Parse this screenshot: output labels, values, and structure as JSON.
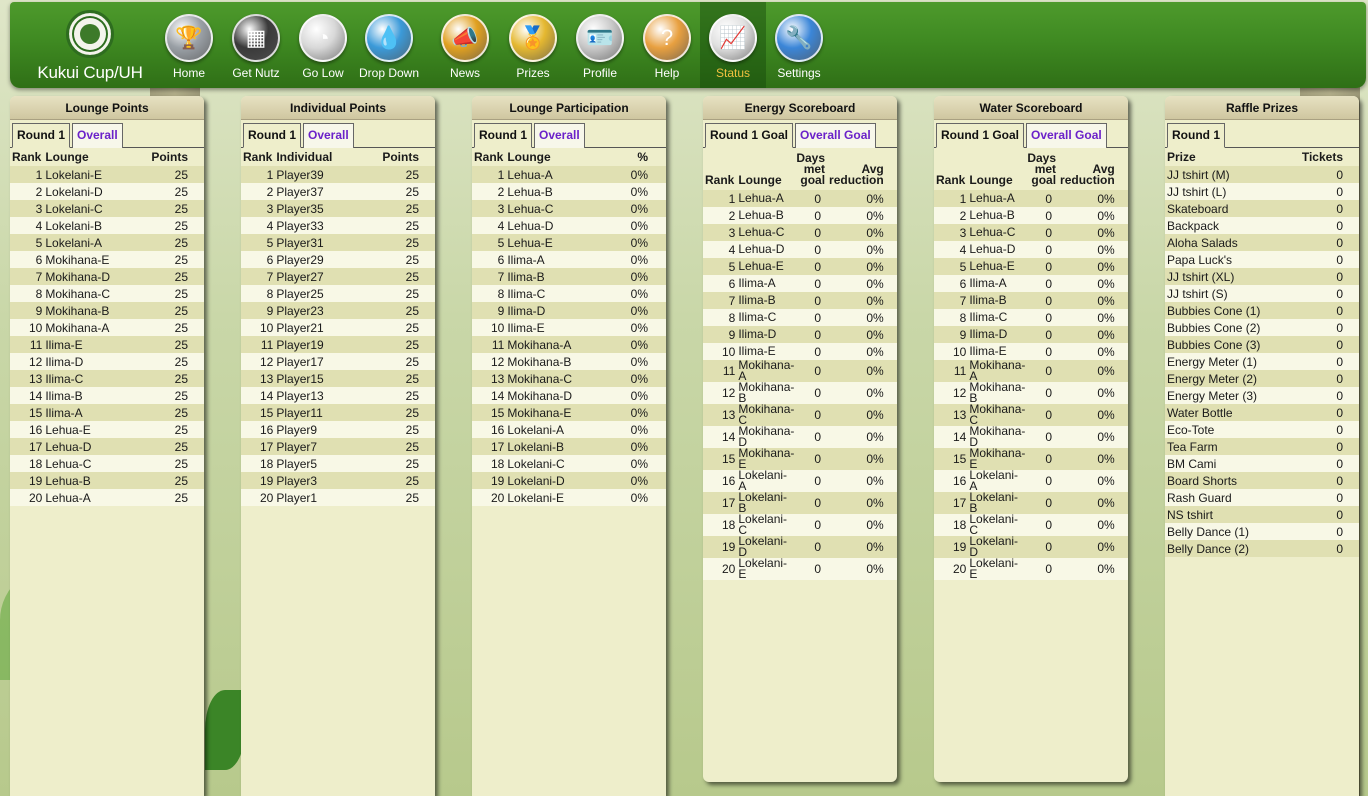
{
  "brand": {
    "name": "Kukui Cup/UH"
  },
  "nav": [
    {
      "label": "Home",
      "icon": "trophy-icon",
      "color": "#9aa0a6",
      "glyph": "🏆"
    },
    {
      "label": "Get Nutz",
      "icon": "scoreboard-icon",
      "color": "#3a3a3a",
      "glyph": "▦"
    },
    {
      "label": "Go Low",
      "icon": "gauge-icon",
      "color": "#d8d8d8",
      "glyph": "◔"
    },
    {
      "label": "Drop Down",
      "icon": "water-drop-icon",
      "color": "#3b9ad9",
      "glyph": "💧"
    },
    {
      "label": "News",
      "icon": "megaphone-icon",
      "color": "#e0a020",
      "glyph": "📣"
    },
    {
      "label": "Prizes",
      "icon": "medal-icon",
      "color": "#e5b830",
      "glyph": "🏅"
    },
    {
      "label": "Profile",
      "icon": "id-card-icon",
      "color": "#c9c9c9",
      "glyph": "🪪"
    },
    {
      "label": "Help",
      "icon": "question-icon",
      "color": "#e8a040",
      "glyph": "?"
    },
    {
      "label": "Status",
      "icon": "status-chart-icon",
      "color": "#e0e0e0",
      "glyph": "📈"
    },
    {
      "label": "Settings",
      "icon": "wrench-icon",
      "color": "#3b86d8",
      "glyph": "🔧"
    }
  ],
  "lounge_points": {
    "title": "Lounge Points",
    "tabs": [
      "Round 1",
      "Overall"
    ],
    "headers": [
      "Rank",
      "Lounge",
      "Points"
    ],
    "rows": [
      [
        "1",
        "Lokelani-E",
        "25"
      ],
      [
        "2",
        "Lokelani-D",
        "25"
      ],
      [
        "3",
        "Lokelani-C",
        "25"
      ],
      [
        "4",
        "Lokelani-B",
        "25"
      ],
      [
        "5",
        "Lokelani-A",
        "25"
      ],
      [
        "6",
        "Mokihana-E",
        "25"
      ],
      [
        "7",
        "Mokihana-D",
        "25"
      ],
      [
        "8",
        "Mokihana-C",
        "25"
      ],
      [
        "9",
        "Mokihana-B",
        "25"
      ],
      [
        "10",
        "Mokihana-A",
        "25"
      ],
      [
        "11",
        "Ilima-E",
        "25"
      ],
      [
        "12",
        "Ilima-D",
        "25"
      ],
      [
        "13",
        "Ilima-C",
        "25"
      ],
      [
        "14",
        "Ilima-B",
        "25"
      ],
      [
        "15",
        "Ilima-A",
        "25"
      ],
      [
        "16",
        "Lehua-E",
        "25"
      ],
      [
        "17",
        "Lehua-D",
        "25"
      ],
      [
        "18",
        "Lehua-C",
        "25"
      ],
      [
        "19",
        "Lehua-B",
        "25"
      ],
      [
        "20",
        "Lehua-A",
        "25"
      ]
    ]
  },
  "individual_points": {
    "title": "Individual Points",
    "tabs": [
      "Round 1",
      "Overall"
    ],
    "headers": [
      "Rank",
      "Individual",
      "Points"
    ],
    "rows": [
      [
        "1",
        "Player39",
        "25"
      ],
      [
        "2",
        "Player37",
        "25"
      ],
      [
        "3",
        "Player35",
        "25"
      ],
      [
        "4",
        "Player33",
        "25"
      ],
      [
        "5",
        "Player31",
        "25"
      ],
      [
        "6",
        "Player29",
        "25"
      ],
      [
        "7",
        "Player27",
        "25"
      ],
      [
        "8",
        "Player25",
        "25"
      ],
      [
        "9",
        "Player23",
        "25"
      ],
      [
        "10",
        "Player21",
        "25"
      ],
      [
        "11",
        "Player19",
        "25"
      ],
      [
        "12",
        "Player17",
        "25"
      ],
      [
        "13",
        "Player15",
        "25"
      ],
      [
        "14",
        "Player13",
        "25"
      ],
      [
        "15",
        "Player11",
        "25"
      ],
      [
        "16",
        "Player9",
        "25"
      ],
      [
        "17",
        "Player7",
        "25"
      ],
      [
        "18",
        "Player5",
        "25"
      ],
      [
        "19",
        "Player3",
        "25"
      ],
      [
        "20",
        "Player1",
        "25"
      ]
    ]
  },
  "lounge_participation": {
    "title": "Lounge Participation",
    "tabs": [
      "Round 1",
      "Overall"
    ],
    "headers": [
      "Rank",
      "Lounge",
      "%"
    ],
    "rows": [
      [
        "1",
        "Lehua-A",
        "0%"
      ],
      [
        "2",
        "Lehua-B",
        "0%"
      ],
      [
        "3",
        "Lehua-C",
        "0%"
      ],
      [
        "4",
        "Lehua-D",
        "0%"
      ],
      [
        "5",
        "Lehua-E",
        "0%"
      ],
      [
        "6",
        "Ilima-A",
        "0%"
      ],
      [
        "7",
        "Ilima-B",
        "0%"
      ],
      [
        "8",
        "Ilima-C",
        "0%"
      ],
      [
        "9",
        "Ilima-D",
        "0%"
      ],
      [
        "10",
        "Ilima-E",
        "0%"
      ],
      [
        "11",
        "Mokihana-A",
        "0%"
      ],
      [
        "12",
        "Mokihana-B",
        "0%"
      ],
      [
        "13",
        "Mokihana-C",
        "0%"
      ],
      [
        "14",
        "Mokihana-D",
        "0%"
      ],
      [
        "15",
        "Mokihana-E",
        "0%"
      ],
      [
        "16",
        "Lokelani-A",
        "0%"
      ],
      [
        "17",
        "Lokelani-B",
        "0%"
      ],
      [
        "18",
        "Lokelani-C",
        "0%"
      ],
      [
        "19",
        "Lokelani-D",
        "0%"
      ],
      [
        "20",
        "Lokelani-E",
        "0%"
      ]
    ]
  },
  "energy_scoreboard": {
    "title": "Energy Scoreboard",
    "tabs": [
      "Round 1 Goal",
      "Overall Goal"
    ],
    "headers": [
      "Rank",
      "Lounge",
      "Days met goal",
      "Avg reduction"
    ],
    "rows": [
      [
        "1",
        "Lehua-A",
        "0",
        "0%"
      ],
      [
        "2",
        "Lehua-B",
        "0",
        "0%"
      ],
      [
        "3",
        "Lehua-C",
        "0",
        "0%"
      ],
      [
        "4",
        "Lehua-D",
        "0",
        "0%"
      ],
      [
        "5",
        "Lehua-E",
        "0",
        "0%"
      ],
      [
        "6",
        "Ilima-A",
        "0",
        "0%"
      ],
      [
        "7",
        "Ilima-B",
        "0",
        "0%"
      ],
      [
        "8",
        "Ilima-C",
        "0",
        "0%"
      ],
      [
        "9",
        "Ilima-D",
        "0",
        "0%"
      ],
      [
        "10",
        "Ilima-E",
        "0",
        "0%"
      ],
      [
        "11",
        "Mokihana-A",
        "0",
        "0%"
      ],
      [
        "12",
        "Mokihana-B",
        "0",
        "0%"
      ],
      [
        "13",
        "Mokihana-C",
        "0",
        "0%"
      ],
      [
        "14",
        "Mokihana-D",
        "0",
        "0%"
      ],
      [
        "15",
        "Mokihana-E",
        "0",
        "0%"
      ],
      [
        "16",
        "Lokelani-A",
        "0",
        "0%"
      ],
      [
        "17",
        "Lokelani-B",
        "0",
        "0%"
      ],
      [
        "18",
        "Lokelani-C",
        "0",
        "0%"
      ],
      [
        "19",
        "Lokelani-D",
        "0",
        "0%"
      ],
      [
        "20",
        "Lokelani-E",
        "0",
        "0%"
      ]
    ]
  },
  "water_scoreboard": {
    "title": "Water Scoreboard",
    "tabs": [
      "Round 1 Goal",
      "Overall Goal"
    ],
    "headers": [
      "Rank",
      "Lounge",
      "Days met goal",
      "Avg reduction"
    ],
    "rows": [
      [
        "1",
        "Lehua-A",
        "0",
        "0%"
      ],
      [
        "2",
        "Lehua-B",
        "0",
        "0%"
      ],
      [
        "3",
        "Lehua-C",
        "0",
        "0%"
      ],
      [
        "4",
        "Lehua-D",
        "0",
        "0%"
      ],
      [
        "5",
        "Lehua-E",
        "0",
        "0%"
      ],
      [
        "6",
        "Ilima-A",
        "0",
        "0%"
      ],
      [
        "7",
        "Ilima-B",
        "0",
        "0%"
      ],
      [
        "8",
        "Ilima-C",
        "0",
        "0%"
      ],
      [
        "9",
        "Ilima-D",
        "0",
        "0%"
      ],
      [
        "10",
        "Ilima-E",
        "0",
        "0%"
      ],
      [
        "11",
        "Mokihana-A",
        "0",
        "0%"
      ],
      [
        "12",
        "Mokihana-B",
        "0",
        "0%"
      ],
      [
        "13",
        "Mokihana-C",
        "0",
        "0%"
      ],
      [
        "14",
        "Mokihana-D",
        "0",
        "0%"
      ],
      [
        "15",
        "Mokihana-E",
        "0",
        "0%"
      ],
      [
        "16",
        "Lokelani-A",
        "0",
        "0%"
      ],
      [
        "17",
        "Lokelani-B",
        "0",
        "0%"
      ],
      [
        "18",
        "Lokelani-C",
        "0",
        "0%"
      ],
      [
        "19",
        "Lokelani-D",
        "0",
        "0%"
      ],
      [
        "20",
        "Lokelani-E",
        "0",
        "0%"
      ]
    ]
  },
  "raffle_prizes": {
    "title": "Raffle Prizes",
    "tabs": [
      "Round 1"
    ],
    "headers": [
      "Prize",
      "Tickets"
    ],
    "rows": [
      [
        "JJ tshirt (M)",
        "0"
      ],
      [
        "JJ tshirt (L)",
        "0"
      ],
      [
        "Skateboard",
        "0"
      ],
      [
        "Backpack",
        "0"
      ],
      [
        "Aloha Salads",
        "0"
      ],
      [
        "Papa Luck's",
        "0"
      ],
      [
        "JJ tshirt (XL)",
        "0"
      ],
      [
        "JJ tshirt (S)",
        "0"
      ],
      [
        "Bubbies Cone (1)",
        "0"
      ],
      [
        "Bubbies Cone (2)",
        "0"
      ],
      [
        "Bubbies Cone (3)",
        "0"
      ],
      [
        "Energy Meter (1)",
        "0"
      ],
      [
        "Energy Meter (2)",
        "0"
      ],
      [
        "Energy Meter (3)",
        "0"
      ],
      [
        "Water Bottle",
        "0"
      ],
      [
        "Eco-Tote",
        "0"
      ],
      [
        "Tea Farm",
        "0"
      ],
      [
        "BM Cami",
        "0"
      ],
      [
        "Board Shorts",
        "0"
      ],
      [
        "Rash Guard",
        "0"
      ],
      [
        "NS tshirt",
        "0"
      ],
      [
        "Belly Dance (1)",
        "0"
      ],
      [
        "Belly Dance (2)",
        "0"
      ]
    ]
  }
}
